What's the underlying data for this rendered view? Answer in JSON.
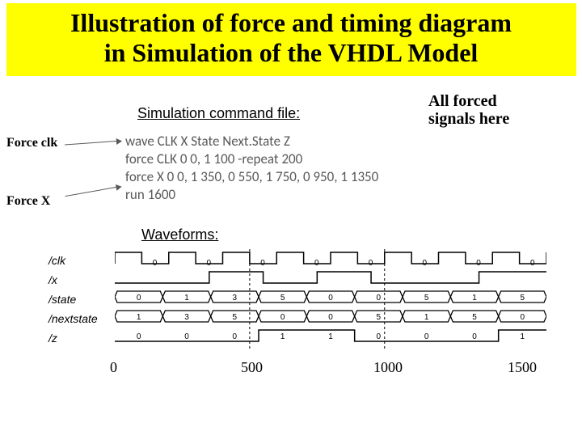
{
  "title_line1": "Illustration of force and timing diagram",
  "title_line2": "in Simulation of the VHDL Model",
  "subhead": "Simulation command file:",
  "all_forced_l1": "All forced",
  "all_forced_l2": "signals here",
  "label_clk": "Force clk",
  "label_x": "Force X",
  "cmd": {
    "l1": "wave CLK X State Next.State Z",
    "l2": "force CLK 0 0, 1 100 -repeat 200",
    "l3": "force X 0 0, 1 350, 0 550, 1 750, 0 950, 1 1350",
    "l4": "run 1600"
  },
  "wave_head": "Waveforms:",
  "signals": {
    "clk": "/clk",
    "x": "/x",
    "state": "/state",
    "nextstate": "/nextstate",
    "z": "/z"
  },
  "axis": {
    "t0": "0",
    "t1": "500",
    "t2": "1000",
    "t3": "1500"
  },
  "chart_data": {
    "type": "table",
    "time_axis": [
      0,
      500,
      1000,
      1500
    ],
    "run_time": 1600,
    "clk": {
      "period": 200,
      "low": 0,
      "high": 100,
      "values_at_cycles": [
        0,
        0,
        0,
        0,
        0,
        0,
        0,
        0
      ]
    },
    "x": {
      "transitions": [
        [
          0,
          0
        ],
        [
          350,
          1
        ],
        [
          550,
          0
        ],
        [
          750,
          1
        ],
        [
          950,
          0
        ],
        [
          1350,
          1
        ]
      ]
    },
    "state_values": [
      0,
      1,
      3,
      5,
      0,
      0,
      5,
      1,
      5
    ],
    "nextstate_values": [
      1,
      3,
      5,
      0,
      0,
      5,
      1,
      5,
      0
    ],
    "z_values": [
      0,
      0,
      0,
      1,
      1,
      0,
      0,
      0,
      1
    ]
  }
}
